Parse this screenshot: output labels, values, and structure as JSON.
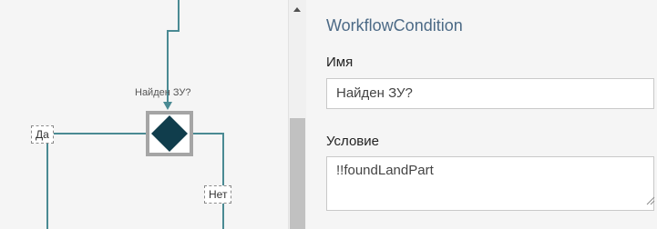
{
  "canvas": {
    "decision_node": {
      "caption": "Найден ЗУ?"
    },
    "branches": {
      "yes_label": "Да",
      "no_label": "Нет"
    }
  },
  "properties": {
    "title": "WorkflowCondition",
    "name": {
      "label": "Имя",
      "value": "Найден ЗУ?"
    },
    "condition": {
      "label": "Условие",
      "value": "!!foundLandPart"
    }
  },
  "colors": {
    "connector": "#4a8a93",
    "decision_fill": "#103d4c",
    "selection": "#a5a5a5",
    "title": "#4c6a86"
  }
}
